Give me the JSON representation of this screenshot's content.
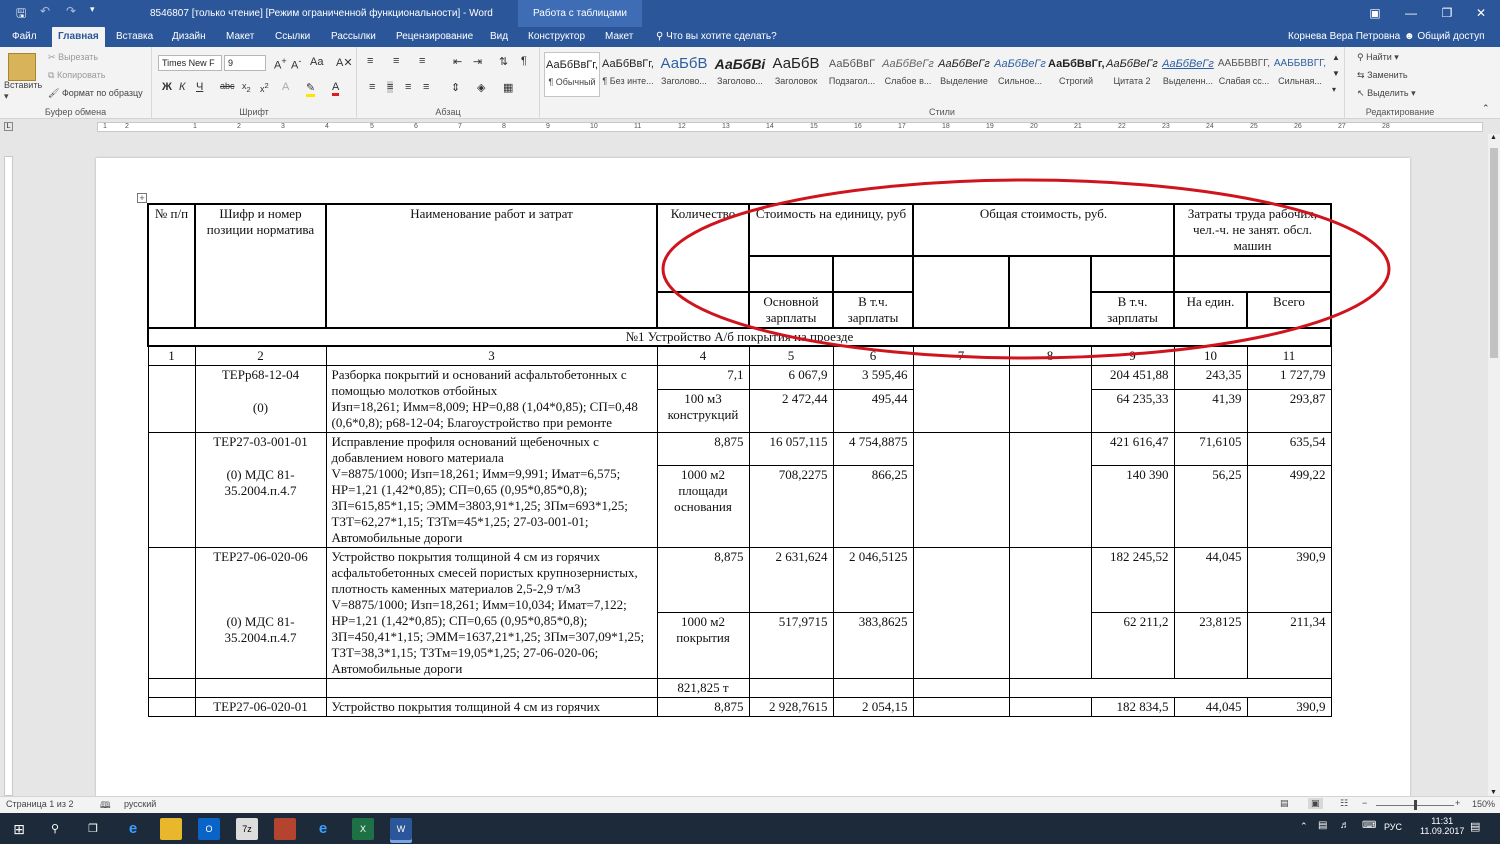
{
  "window": {
    "title": "8546807 [только чтение] [Режим ограниченной функциональности] - Word",
    "context_tab": "Работа с таблицами",
    "user": "Корнева Вера Петровна",
    "share": "Общий доступ",
    "tell_me": "Что вы хотите сделать?"
  },
  "tabs": [
    "Файл",
    "Главная",
    "Вставка",
    "Дизайн",
    "Макет",
    "Ссылки",
    "Рассылки",
    "Рецензирование",
    "Вид",
    "Конструктор",
    "Макет"
  ],
  "ribbon": {
    "paste": "Вставить",
    "cut": "Вырезать",
    "copy": "Копировать",
    "format_painter": "Формат по образцу",
    "clipboard_label": "Буфер обмена",
    "font_name": "Times New F",
    "font_size": "9",
    "font_label": "Шрифт",
    "paragraph_label": "Абзац",
    "styles_label": "Стили",
    "find": "Найти",
    "replace": "Заменить",
    "select": "Выделить",
    "editing_label": "Редактирование",
    "styles": [
      {
        "sample": "АаБбВвГг,",
        "name": "¶ Обычный"
      },
      {
        "sample": "АаБбВвГг,",
        "name": "¶ Без инте..."
      },
      {
        "sample": "АаБбВ",
        "name": "Заголово..."
      },
      {
        "sample": "АаБбВі",
        "name": "Заголово..."
      },
      {
        "sample": "АаБбВ",
        "name": "Заголовок"
      },
      {
        "sample": "АаБбВвГ",
        "name": "Подзагол..."
      },
      {
        "sample": "АаБбВеГг",
        "name": "Слабое в..."
      },
      {
        "sample": "АаБбВеГг",
        "name": "Выделение"
      },
      {
        "sample": "АаБбВеГг",
        "name": "Сильное..."
      },
      {
        "sample": "АаБбВвГг,",
        "name": "Строгий"
      },
      {
        "sample": "АаБбВеГг",
        "name": "Цитата 2"
      },
      {
        "sample": "АаБбВеГг",
        "name": "Выделенн..."
      },
      {
        "sample": "ААББВВГГ,",
        "name": "Слабая сс..."
      },
      {
        "sample": "ААББВВГГ,",
        "name": "Сильная..."
      }
    ]
  },
  "ruler_ticks": [
    "1",
    "2",
    "1",
    "2",
    "3",
    "4",
    "5",
    "6",
    "7",
    "8",
    "9",
    "10",
    "11",
    "12",
    "13",
    "14",
    "15",
    "16",
    "17",
    "18",
    "19",
    "20",
    "21",
    "22",
    "23",
    "24",
    "25",
    "26",
    "27",
    "28"
  ],
  "table": {
    "h_num": "№ п/п",
    "h_code": "Шифр и номер позиции норматива",
    "h_name": "Наименование работ и затрат",
    "h_qty": "Количество",
    "h_unit_cost": "Стоимость на единицу, руб",
    "h_total": "Общая стоимость, руб.",
    "h_labor": "Затраты труда рабочих, чел.-ч. не занят. обсл. машин",
    "h_base": "Основной зарплаты",
    "h_incl_wage": "В т.ч. зарплаты",
    "h_incl_wage2": "В т.ч. зарплаты",
    "h_per_unit": "На един.",
    "h_all": "Всего",
    "section": "№1 Устройство А/б покрытия на проезде",
    "colnums": [
      "1",
      "2",
      "3",
      "4",
      "5",
      "6",
      "7",
      "8",
      "9",
      "10",
      "11"
    ],
    "rows": [
      {
        "code1": "ТЕРр68-12-04",
        "code2": "(0)",
        "name1": "Разборка покрытий и оснований асфальтобетонных с помощью молотков отбойных",
        "name2": "Изп=18,261; Имм=8,009; НР=0,88 (1,04*0,85); СП=0,48 (0,6*0,8); р68-12-04; Благоустройство при ремонте",
        "qty1": "7,1",
        "qty2": "100 м3 конструкций",
        "c5a": "6 067,9",
        "c5b": "2 472,44",
        "c6a": "3 595,46",
        "c6b": "495,44",
        "c9a": "204 451,88",
        "c9b": "64 235,33",
        "c10a": "243,35",
        "c10b": "41,39",
        "c11a": "1 727,79",
        "c11b": "293,87"
      },
      {
        "code1": "ТЕР27-03-001-01",
        "code2": "(0) МДС 81-35.2004.п.4.7",
        "name1": "Исправление профиля оснований щебеночных с добавлением нового материала",
        "name2": "V=8875/1000; Изп=18,261; Имм=9,991; Имат=6,575; НР=1,21 (1,42*0,85); СП=0,65 (0,95*0,85*0,8); ЗП=615,85*1,15; ЭММ=3803,91*1,25; ЗПм=693*1,25; ТЗТ=62,27*1,15; ТЗТм=45*1,25; 27-03-001-01; Автомобильные дороги",
        "qty1": "8,875",
        "qty2": "1000 м2 площади основания",
        "c5a": "16 057,115",
        "c5b": "708,2275",
        "c6a": "4 754,8875",
        "c6b": "866,25",
        "c9a": "421 616,47",
        "c9b": "140 390",
        "c10a": "71,6105",
        "c10b": "56,25",
        "c11a": "635,54",
        "c11b": "499,22"
      },
      {
        "code1": "ТЕР27-06-020-06",
        "code2": "(0) МДС 81-35.2004.п.4.7",
        "name1": "Устройство покрытия толщиной 4 см из горячих асфальтобетонных смесей пористых крупнозернистых, плотность каменных материалов 2,5-2,9 т/м3",
        "name2": "V=8875/1000; Изп=18,261; Имм=10,034; Имат=7,122; НР=1,21 (1,42*0,85); СП=0,65 (0,95*0,85*0,8); ЗП=450,41*1,15; ЭММ=1637,21*1,25; ЗПм=307,09*1,25; ТЗТ=38,3*1,15; ТЗТм=19,05*1,25; 27-06-020-06; Автомобильные дороги",
        "qty1": "8,875",
        "qty2": "1000 м2 покрытия",
        "c5a": "2 631,624",
        "c5b": "517,9715",
        "c6a": "2 046,5125",
        "c6b": "383,8625",
        "c9a": "182 245,52",
        "c9b": "62 211,2",
        "c10a": "44,045",
        "c10b": "23,8125",
        "c11a": "390,9",
        "c11b": "211,34"
      }
    ],
    "extra_qty": "821,825 т",
    "last": {
      "code1": "ТЕР27-06-020-01",
      "name1": "Устройство покрытия толщиной 4 см из горячих",
      "qty1": "8,875",
      "c5a": "2 928,7615",
      "c6a": "2 054,15",
      "c9a": "182 834,5",
      "c10a": "44,045",
      "c11a": "390,9"
    }
  },
  "status": {
    "page": "Страница 1 из 2",
    "lang": "русский",
    "zoom": "150%"
  },
  "taskbar": {
    "lang": "РУС",
    "time": "11:31",
    "date": "11.09.2017"
  },
  "colors": {
    "word_blue": "#2b579a",
    "annotation": "#d0141e"
  }
}
